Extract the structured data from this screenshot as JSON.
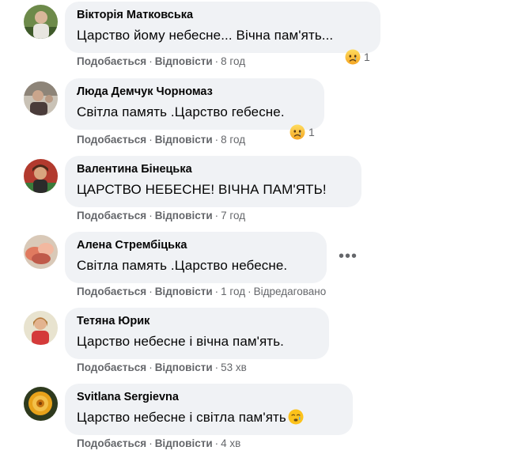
{
  "actions": {
    "like": "Подобається",
    "reply": "Відповісти",
    "dot": "·"
  },
  "comments": [
    {
      "author": "Вікторія Матковська",
      "text": "Царство йому небесне... Вічна пам'ять...",
      "time": "8 год",
      "reaction_count": "1",
      "reaction_icon": "sad-emoji-icon"
    },
    {
      "author": "Люда Демчук Чорномаз",
      "text": "Світла память .Царство гебесне.",
      "time": "8 год",
      "reaction_count": "1",
      "reaction_icon": "sad-emoji-icon"
    },
    {
      "author": "Валентина Бінецька",
      "text": "ЦАРСТВО НЕБЕСНЕ! ВІЧНА ПАМ'ЯТЬ!",
      "time": "7 год"
    },
    {
      "author": "Алена Стрембіцька",
      "text": "Світла память .Царство небесне.",
      "time": "1 год",
      "edited": "Відредаговано",
      "more_icon": "more-options-icon"
    },
    {
      "author": "Тетяна Юрик",
      "text": "Царство небесне і вічна пам'ять.",
      "time": "53 хв"
    },
    {
      "author": "Svitlana Sergievna",
      "text": "Царство небесне і світла пам'ять",
      "time": "4 хв",
      "inline_icon": "crying-emoji-icon"
    }
  ],
  "colors": {
    "bubble": "#f0f2f5",
    "meta": "#65676b",
    "text": "#050505",
    "emoji": "#f7b125"
  }
}
